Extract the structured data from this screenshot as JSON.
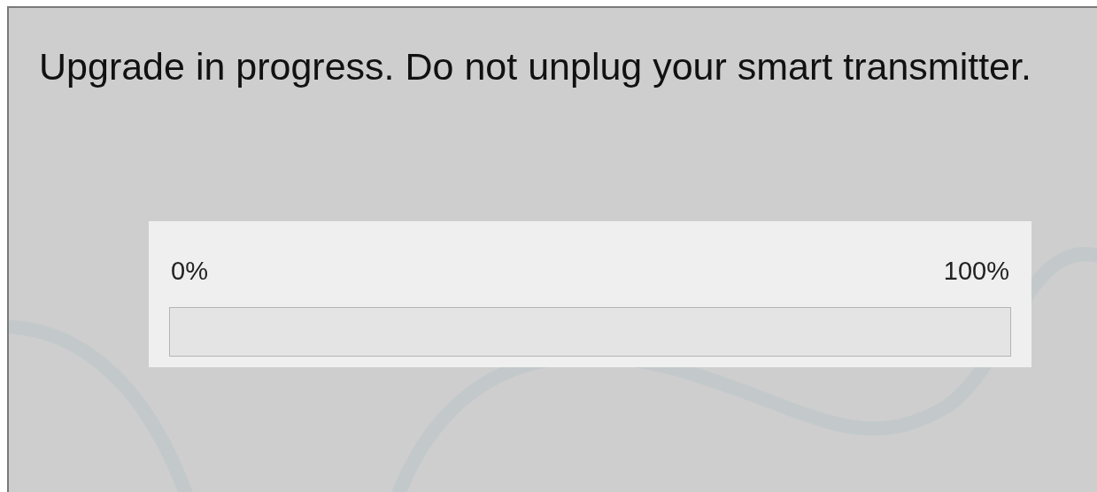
{
  "dialog": {
    "message": "Upgrade in progress. Do not unplug your smart transmitter.",
    "progress": {
      "min_label": "0%",
      "max_label": "100%",
      "level": 0
    }
  }
}
